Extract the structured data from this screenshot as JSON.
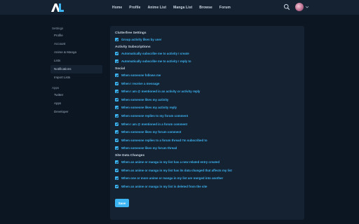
{
  "nav": {
    "links": [
      "Home",
      "Profile",
      "Anime List",
      "Manga List",
      "Browse",
      "Forum"
    ],
    "search_icon": "search-icon",
    "chevron_icon": "chevron-down-icon"
  },
  "sidebar": {
    "settings_heading": "Settings",
    "settings_items": [
      "Profile",
      "Account",
      "Anime & Manga",
      "Lists",
      "Notifications",
      "Import Lists"
    ],
    "active_item": "Notifications",
    "apps_heading": "Apps",
    "apps_items": [
      "Twitter",
      "Apps",
      "Developer"
    ]
  },
  "main": {
    "sections": [
      {
        "title": "Clutterfree Settings",
        "options": [
          {
            "label": "Group activity likes by user",
            "checked": true
          }
        ]
      },
      {
        "title": "Activity Subscriptions",
        "options": [
          {
            "label": "Automatically subscribe me to activity I create",
            "checked": true
          },
          {
            "label": "Automatically subscribe me to activity I reply to",
            "checked": true
          }
        ]
      },
      {
        "title": "Social",
        "options": [
          {
            "label": "When someone follows me",
            "checked": true
          },
          {
            "label": "When I receive a message",
            "checked": true
          },
          {
            "label": "When I am @ mentioned in an activity or activity reply",
            "checked": true
          },
          {
            "label": "When someone likes my activity",
            "checked": true
          },
          {
            "label": "When someone likes my activity reply",
            "checked": true
          },
          {
            "label": "When someone replies to my forum comment",
            "checked": true
          },
          {
            "label": "When I am @ mentioned in a forum comment",
            "checked": true
          },
          {
            "label": "When someone likes my forum comment",
            "checked": true
          },
          {
            "label": "When someone replies to a forum thread I'm subscribed to",
            "checked": true
          },
          {
            "label": "When someone likes my forum thread",
            "checked": true
          }
        ]
      },
      {
        "title": "Site Data Changes",
        "options": [
          {
            "label": "When an anime or manga in my list has a new related entry created",
            "checked": true
          },
          {
            "label": "When an anime or manga in my list has its data changed that affects my list",
            "checked": true
          },
          {
            "label": "When one or more anime or manga in my list are merged into another",
            "checked": true
          },
          {
            "label": "When an anime or manga in my list is deleted from the site",
            "checked": true
          }
        ]
      }
    ],
    "save_label": "Save"
  },
  "colors": {
    "background": "#0b1622",
    "panel": "#152232",
    "accent": "#3db4f2"
  }
}
